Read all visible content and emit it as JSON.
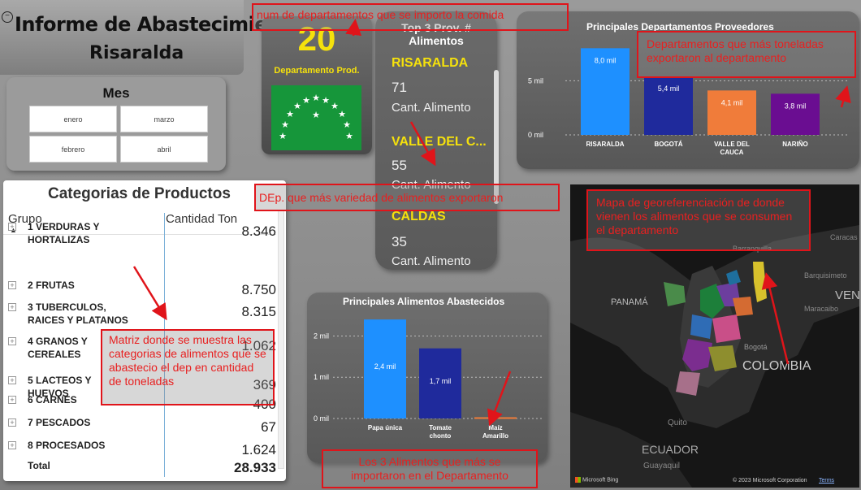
{
  "header": {
    "title": "Informe de Abastecimiento",
    "subtitle": "Risaralda"
  },
  "mes": {
    "title": "Mes",
    "options": [
      "enero",
      "marzo",
      "febrero",
      "abril"
    ]
  },
  "counter": {
    "value": "20",
    "label": "Departamento Prod."
  },
  "top3": {
    "title_line1": "Top 3 Prov. #",
    "title_line2": "Alimentos",
    "items": [
      {
        "name": "RISARALDA",
        "value": "71",
        "sub": "Cant. Alimento"
      },
      {
        "name": "VALLE DEL C...",
        "value": "55",
        "sub": "Cant. Alimento"
      },
      {
        "name": "CALDAS",
        "value": "35",
        "sub": "Cant. Alimento"
      }
    ]
  },
  "departamentos": {
    "title": "Principales Departamentos Proveedores"
  },
  "categorias": {
    "title": "Categorias de Productos",
    "col_group": "Grupo",
    "col_qty": "Cantidad Ton",
    "rows": [
      {
        "name_line1": "1 VERDURAS Y",
        "name_line2": "HORTALIZAS",
        "value": "8.346"
      },
      {
        "name_line1": "2 FRUTAS",
        "name_line2": "",
        "value": "8.750"
      },
      {
        "name_line1": "3 TUBERCULOS,",
        "name_line2": "RAICES Y PLATANOS",
        "value": "8.315"
      },
      {
        "name_line1": "4 GRANOS Y",
        "name_line2": "CEREALES",
        "value": "1.062"
      },
      {
        "name_line1": "5 LACTEOS Y",
        "name_line2": "HUEVOS",
        "value": "369"
      },
      {
        "name_line1": "6 CARNES",
        "name_line2": "",
        "value": "400"
      },
      {
        "name_line1": "7 PESCADOS",
        "name_line2": "",
        "value": "67"
      },
      {
        "name_line1": "8 PROCESADOS",
        "name_line2": "",
        "value": "1.624"
      }
    ],
    "total_label": "Total",
    "total_value": "28.933"
  },
  "alimentos": {
    "title": "Principales Alimentos Abastecidos"
  },
  "map": {
    "labels": [
      "PANAMÁ",
      "VEN",
      "COLOMBIA",
      "ECUADOR",
      "Quito",
      "Bogotá",
      "Barquisimeto",
      "Guayaquil",
      "Barranquilla",
      "Maracaibo",
      "Caracas"
    ],
    "brand": "Microsoft Bing",
    "copyright": "© 2023 Microsoft Corporation",
    "terms": "Terms"
  },
  "annotations": {
    "num_deps": "num de departamentos que se importo la comida",
    "deps_toneladas": "Departamentos que más toneladas exportaron al departamento",
    "variedad": "DEp. que más variedad de alimentos exportaron",
    "mapa": "Mapa de georeferenciación de donde vienen los alimentos que se consumen el departamento",
    "matriz": "Matriz donde se muestra las categorias de alimentos que se abastecio el dep en cantidad de toneladas",
    "alimentos": "Los 3 Alimentos que más se importaron en el Departamento"
  },
  "colors": {
    "accent_yellow": "#f5e10c",
    "annotation_red": "#e0141a"
  },
  "chart_data": [
    {
      "type": "bar",
      "title": "Principales Departamentos Proveedores",
      "categories": [
        "RISARALDA",
        "BOGOTÁ",
        "VALLE DEL CAUCA",
        "NARIÑO"
      ],
      "category_lines": [
        [
          "RISARALDA"
        ],
        [
          "BOGOTÁ"
        ],
        [
          "VALLE DEL",
          "CAUCA"
        ],
        [
          "NARIÑO"
        ]
      ],
      "values": [
        8000,
        5400,
        4100,
        3800
      ],
      "data_labels": [
        "8,0 mil",
        "5,4 mil",
        "4,1 mil",
        "3,8 mil"
      ],
      "colors": [
        "#1e90ff",
        "#1f2a9c",
        "#f07c3a",
        "#6a0d91"
      ],
      "yticks": [
        "5 mil",
        "0 mil"
      ],
      "ytick_values": [
        5000,
        0
      ],
      "ylim": [
        0,
        9000
      ]
    },
    {
      "type": "bar",
      "title": "Principales Alimentos Abastecidos",
      "categories": [
        "Papa única",
        "Tomate chonto",
        "Maíz Amarillo"
      ],
      "category_lines": [
        [
          "Papa única"
        ],
        [
          "Tomate",
          "chonto"
        ],
        [
          "Maíz",
          "Amarillo"
        ]
      ],
      "values": [
        2400,
        1700,
        30
      ],
      "data_labels": [
        "2,4 mil",
        "1,7 mil",
        ""
      ],
      "colors": [
        "#1e90ff",
        "#1f2a9c",
        "#f07c3a"
      ],
      "yticks": [
        "2 mil",
        "1 mil",
        "0 mil"
      ],
      "ytick_values": [
        2000,
        1000,
        0
      ],
      "ylim": [
        0,
        2600
      ]
    }
  ]
}
